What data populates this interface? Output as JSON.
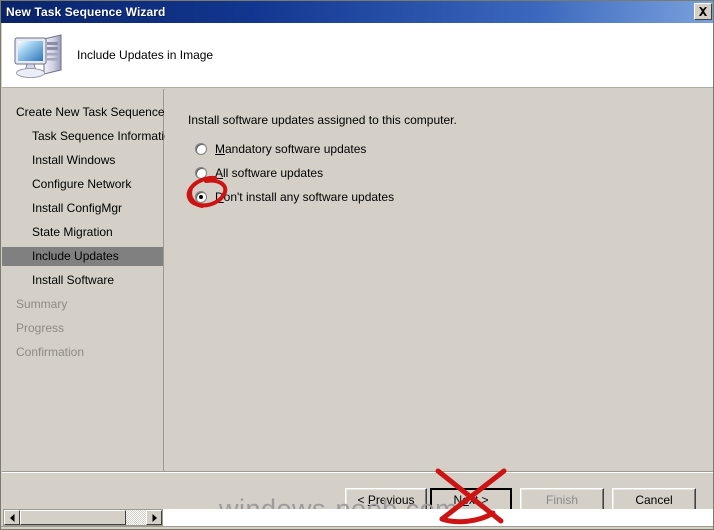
{
  "window": {
    "title": "New Task Sequence Wizard",
    "close_label": "Close",
    "close_icon": "close-x-icon"
  },
  "header": {
    "title": "Include Updates in Image",
    "icon": "computer-monitor-icon"
  },
  "sidebar": {
    "items": [
      {
        "label": "Create New Task Sequence",
        "level": 0,
        "state": "done"
      },
      {
        "label": "Task Sequence Information",
        "level": 1,
        "state": "done"
      },
      {
        "label": "Install Windows",
        "level": 1,
        "state": "done"
      },
      {
        "label": "Configure Network",
        "level": 1,
        "state": "done"
      },
      {
        "label": "Install ConfigMgr",
        "level": 1,
        "state": "done"
      },
      {
        "label": "State Migration",
        "level": 1,
        "state": "done"
      },
      {
        "label": "Include Updates",
        "level": 1,
        "state": "current"
      },
      {
        "label": "Install Software",
        "level": 1,
        "state": "done"
      },
      {
        "label": "Summary",
        "level": 0,
        "state": "pending"
      },
      {
        "label": "Progress",
        "level": 0,
        "state": "pending"
      },
      {
        "label": "Confirmation",
        "level": 0,
        "state": "pending"
      }
    ]
  },
  "content": {
    "intro": "Install software updates assigned to this computer.",
    "options": [
      {
        "label": "Mandatory software updates",
        "accel": "M",
        "rest": "andatory software updates",
        "selected": false
      },
      {
        "label": "All software updates",
        "accel": "A",
        "rest": "ll software updates",
        "selected": false
      },
      {
        "label": "Don't install any software updates",
        "accel": "D",
        "rest": "on't install any software updates",
        "selected": true
      }
    ]
  },
  "footer": {
    "buttons": [
      {
        "id": "previous",
        "label": "< Previous",
        "pre": "< ",
        "accel": "P",
        "rest": "revious",
        "enabled": true,
        "default": false
      },
      {
        "id": "next",
        "label": "Next >",
        "pre": "N",
        "accel": "e",
        "rest": "xt >",
        "enabled": true,
        "default": true
      },
      {
        "id": "finish",
        "label": "Finish",
        "pre": "",
        "accel": "F",
        "rest": "inish",
        "enabled": false,
        "default": false
      },
      {
        "id": "cancel",
        "label": "Cancel",
        "pre": "",
        "accel": "",
        "rest": "Cancel",
        "enabled": true,
        "default": false
      }
    ]
  },
  "watermark": {
    "text": "windows-noob.com"
  },
  "scrollbar": {
    "left_arrow": "triangle-left-icon",
    "right_arrow": "triangle-right-icon"
  },
  "annotations": {
    "circle_target": "Don't install any software updates radio button",
    "cross_target": "Next > button",
    "color": "#cc1414"
  }
}
